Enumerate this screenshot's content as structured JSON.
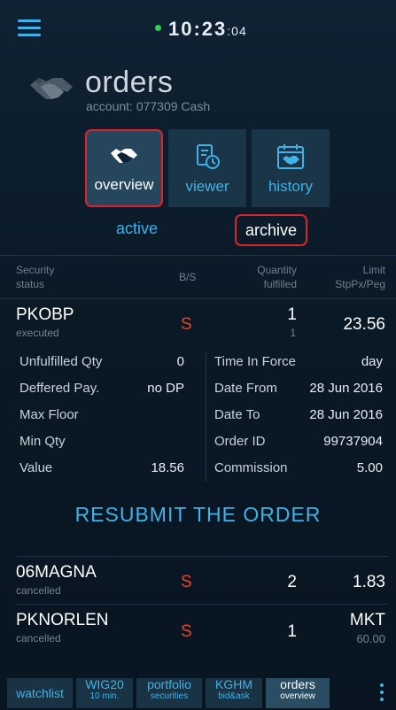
{
  "status": {
    "time_hm": "10:23",
    "time_s": ":04"
  },
  "header": {
    "title": "orders",
    "account": "account: 077309 Cash"
  },
  "views": [
    {
      "label": "overview",
      "icon": "handshake-icon",
      "selected": true
    },
    {
      "label": "viewer",
      "icon": "document-clock-icon",
      "selected": false
    },
    {
      "label": "history",
      "icon": "calendar-handshake-icon",
      "selected": false
    }
  ],
  "subtabs": {
    "active": "active",
    "archive": "archive",
    "selected": "archive"
  },
  "table_header": {
    "c1a": "Security",
    "c1b": "status",
    "c2": "B/S",
    "c3a": "Quantity",
    "c3b": "fulfilled",
    "c4a": "Limit",
    "c4b": "StpPx/Peg"
  },
  "orders": [
    {
      "symbol": "PKOBP",
      "status": "executed",
      "side": "S",
      "qty": "1",
      "fulfilled": "1",
      "price": "23.56",
      "sub": ""
    },
    {
      "symbol": "06MAGNA",
      "status": "cancelled",
      "side": "S",
      "qty": "2",
      "fulfilled": "",
      "price": "1.83",
      "sub": ""
    },
    {
      "symbol": "PKNORLEN",
      "status": "cancelled",
      "side": "S",
      "qty": "1",
      "fulfilled": "",
      "price": "MKT",
      "sub": "60.00"
    }
  ],
  "details": {
    "left": [
      {
        "k": "Unfulfilled Qty",
        "v": "0"
      },
      {
        "k": "Deffered Pay.",
        "v": "no DP"
      },
      {
        "k": "Max Floor",
        "v": ""
      },
      {
        "k": "Min Qty",
        "v": ""
      },
      {
        "k": "Value",
        "v": "18.56"
      }
    ],
    "right": [
      {
        "k": "Time In Force",
        "v": "day"
      },
      {
        "k": "Date From",
        "v": "28 Jun 2016"
      },
      {
        "k": "Date To",
        "v": "28 Jun 2016"
      },
      {
        "k": "Order ID",
        "v": "99737904"
      },
      {
        "k": "Commission",
        "v": "5.00"
      }
    ]
  },
  "resubmit_label": "RESUBMIT THE ORDER",
  "bottom_nav": [
    {
      "t": "watchlist",
      "s": ""
    },
    {
      "t": "WIG20",
      "s": "10 min."
    },
    {
      "t": "portfolio",
      "s": "securities"
    },
    {
      "t": "KGHM",
      "s": "bid&ask"
    },
    {
      "t": "orders",
      "s": "overview",
      "selected": true
    }
  ],
  "colors": {
    "accent": "#3fb2e8",
    "sell": "#e8452c",
    "highlight": "#e0222a",
    "status_dot": "#2fd14a"
  }
}
